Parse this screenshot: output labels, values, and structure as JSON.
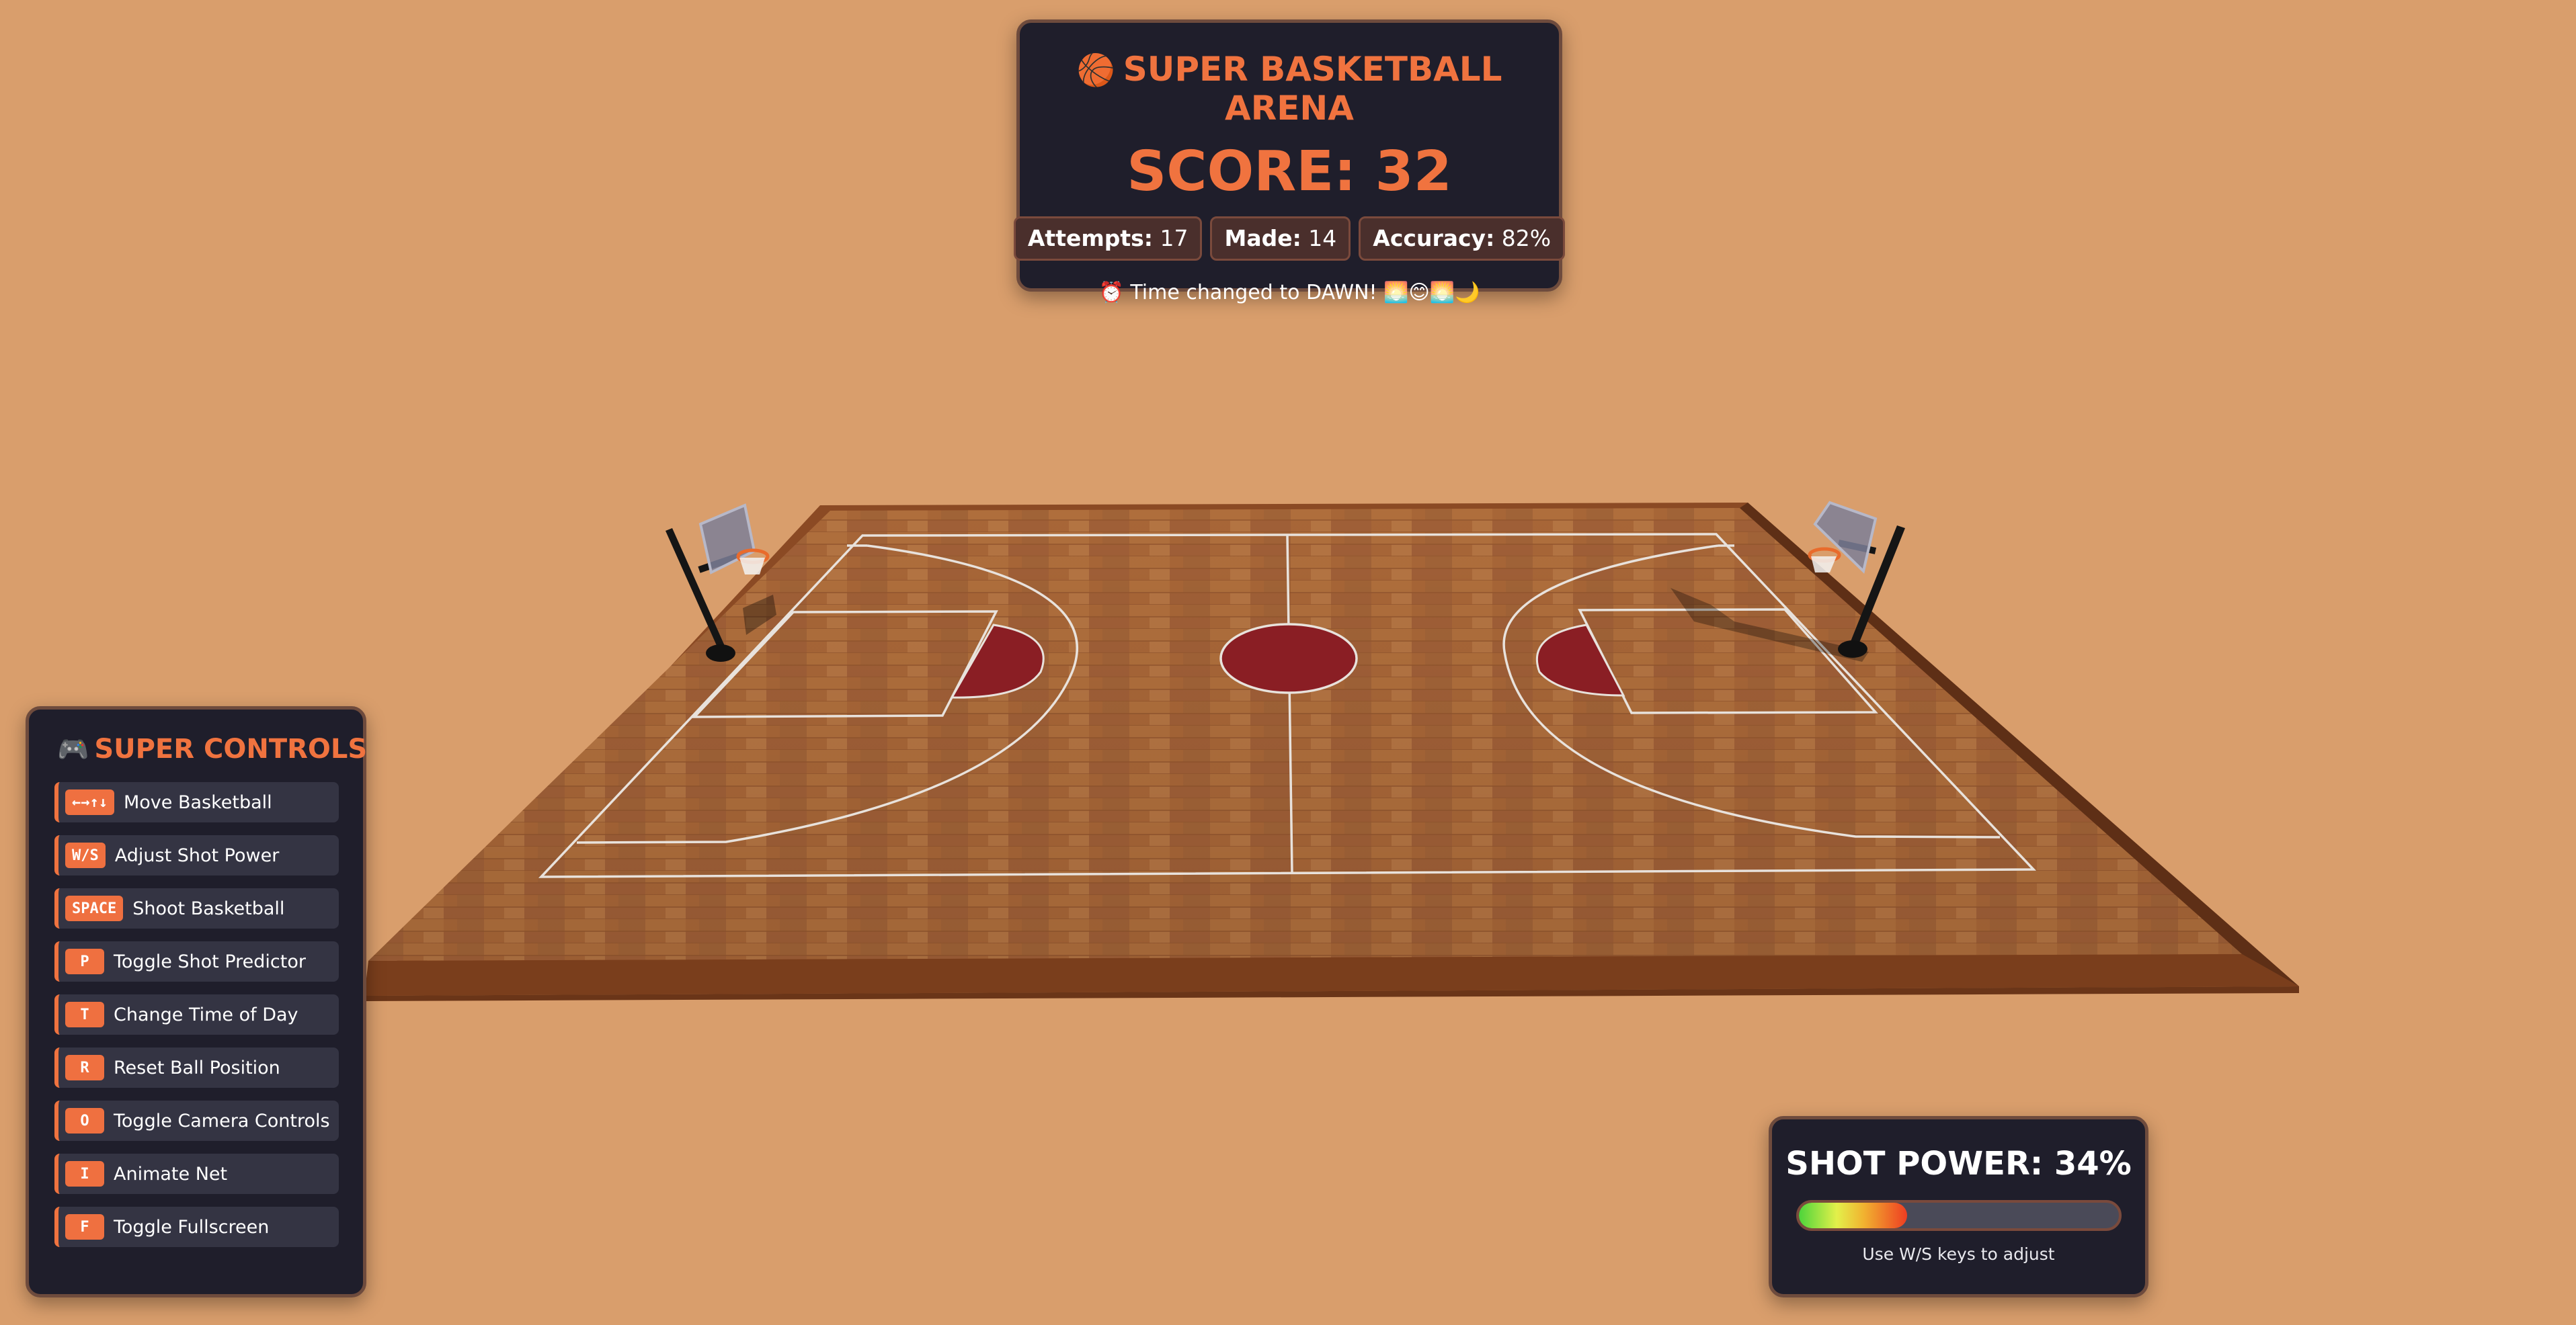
{
  "hud": {
    "ball_icon": "🏀",
    "title": "SUPER BASKETBALL ARENA",
    "score": "SCORE: 32",
    "stats": [
      {
        "key": "Attempts:",
        "value": "17"
      },
      {
        "key": "Made:",
        "value": "14"
      },
      {
        "key": "Accuracy:",
        "value": "82%"
      }
    ],
    "message": "⏰ Time changed to DAWN! 🌅😊🌅🌙"
  },
  "controls": {
    "icon": "🎮",
    "title": "SUPER CONTROLS",
    "items": [
      {
        "key": "←→↑↓",
        "label": "Move Basketball"
      },
      {
        "key": "W/S",
        "label": "Adjust Shot Power"
      },
      {
        "key": "SPACE",
        "label": "Shoot Basketball"
      },
      {
        "key": "P",
        "label": "Toggle Shot Predictor"
      },
      {
        "key": "T",
        "label": "Change Time of Day"
      },
      {
        "key": "R",
        "label": "Reset Ball Position"
      },
      {
        "key": "O",
        "label": "Toggle Camera Controls"
      },
      {
        "key": "I",
        "label": "Animate Net"
      },
      {
        "key": "F",
        "label": "Toggle Fullscreen"
      }
    ]
  },
  "power": {
    "label": "SHOT POWER: 34%",
    "value": 0.34,
    "hint": "Use W/S keys to adjust"
  },
  "colors": {
    "background": "#d99e6c",
    "accent": "#f0733f",
    "panel": "#1f1e2b",
    "court_wood": "#b26e3c",
    "paint_circle": "#8a1e24"
  }
}
